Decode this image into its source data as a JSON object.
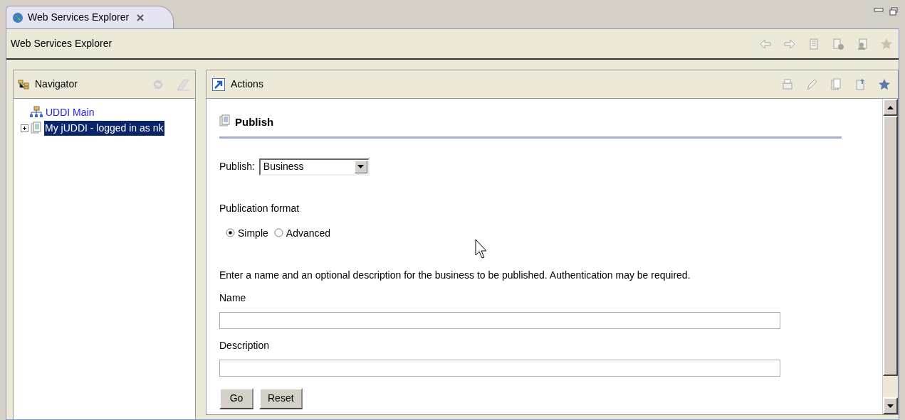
{
  "tabs": [
    {
      "label": "Web Services Explorer",
      "selected": true
    }
  ],
  "toolbar": {
    "title": "Web Services Explorer"
  },
  "navigator": {
    "title": "Navigator",
    "tree": [
      {
        "label": "UDDI Main",
        "selected": false,
        "children": [
          {
            "label": "My jUDDI - logged in as nk",
            "selected": true,
            "expanded": false
          }
        ]
      }
    ]
  },
  "actions": {
    "title": "Actions",
    "heading": "Publish",
    "publish": {
      "label": "Publish:",
      "value": "Business"
    },
    "format": {
      "label": "Publication format",
      "options": [
        {
          "label": "Simple",
          "selected": true
        },
        {
          "label": "Advanced",
          "selected": false
        }
      ]
    },
    "instructions": "Enter a name and an optional description for the business to be published. Authentication may be required.",
    "fields": [
      {
        "label": "Name"
      },
      {
        "label": "Description"
      }
    ],
    "buttons": [
      "Go",
      "Reset"
    ]
  }
}
